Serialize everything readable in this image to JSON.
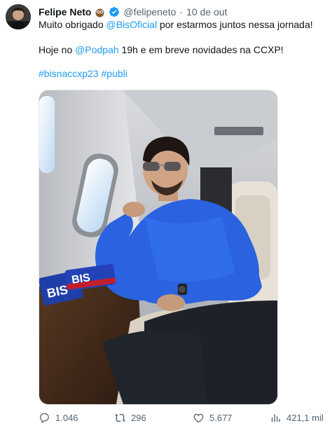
{
  "tweet": {
    "author_name": "Felipe Neto",
    "author_badge_icon": "owl-emoji-icon",
    "verified_icon": "verified-badge-icon",
    "handle": "@felipeneto",
    "separator": "·",
    "timestamp": "10 de out",
    "line1": {
      "prefix": "Muito obrigado ",
      "mention": "@BisOficial",
      "suffix": " por estarmos juntos nessa jornada!"
    },
    "line2": {
      "prefix": "Hoje no ",
      "mention": "@Podpah",
      "suffix": " 19h e em breve novidades na CCXP!"
    },
    "hashtags": "#bisnaccxp23 #publi",
    "media": {
      "product_label_1": "BIS",
      "product_label_2": "BIS"
    },
    "stats": {
      "replies": "1.046",
      "retweets": "296",
      "likes": "5.677",
      "views": "421,1 mil"
    },
    "colors": {
      "link": "#1d9bf0",
      "muted": "#536471",
      "verified": "#1d9bf0",
      "sweater": "#2a62e0"
    }
  }
}
